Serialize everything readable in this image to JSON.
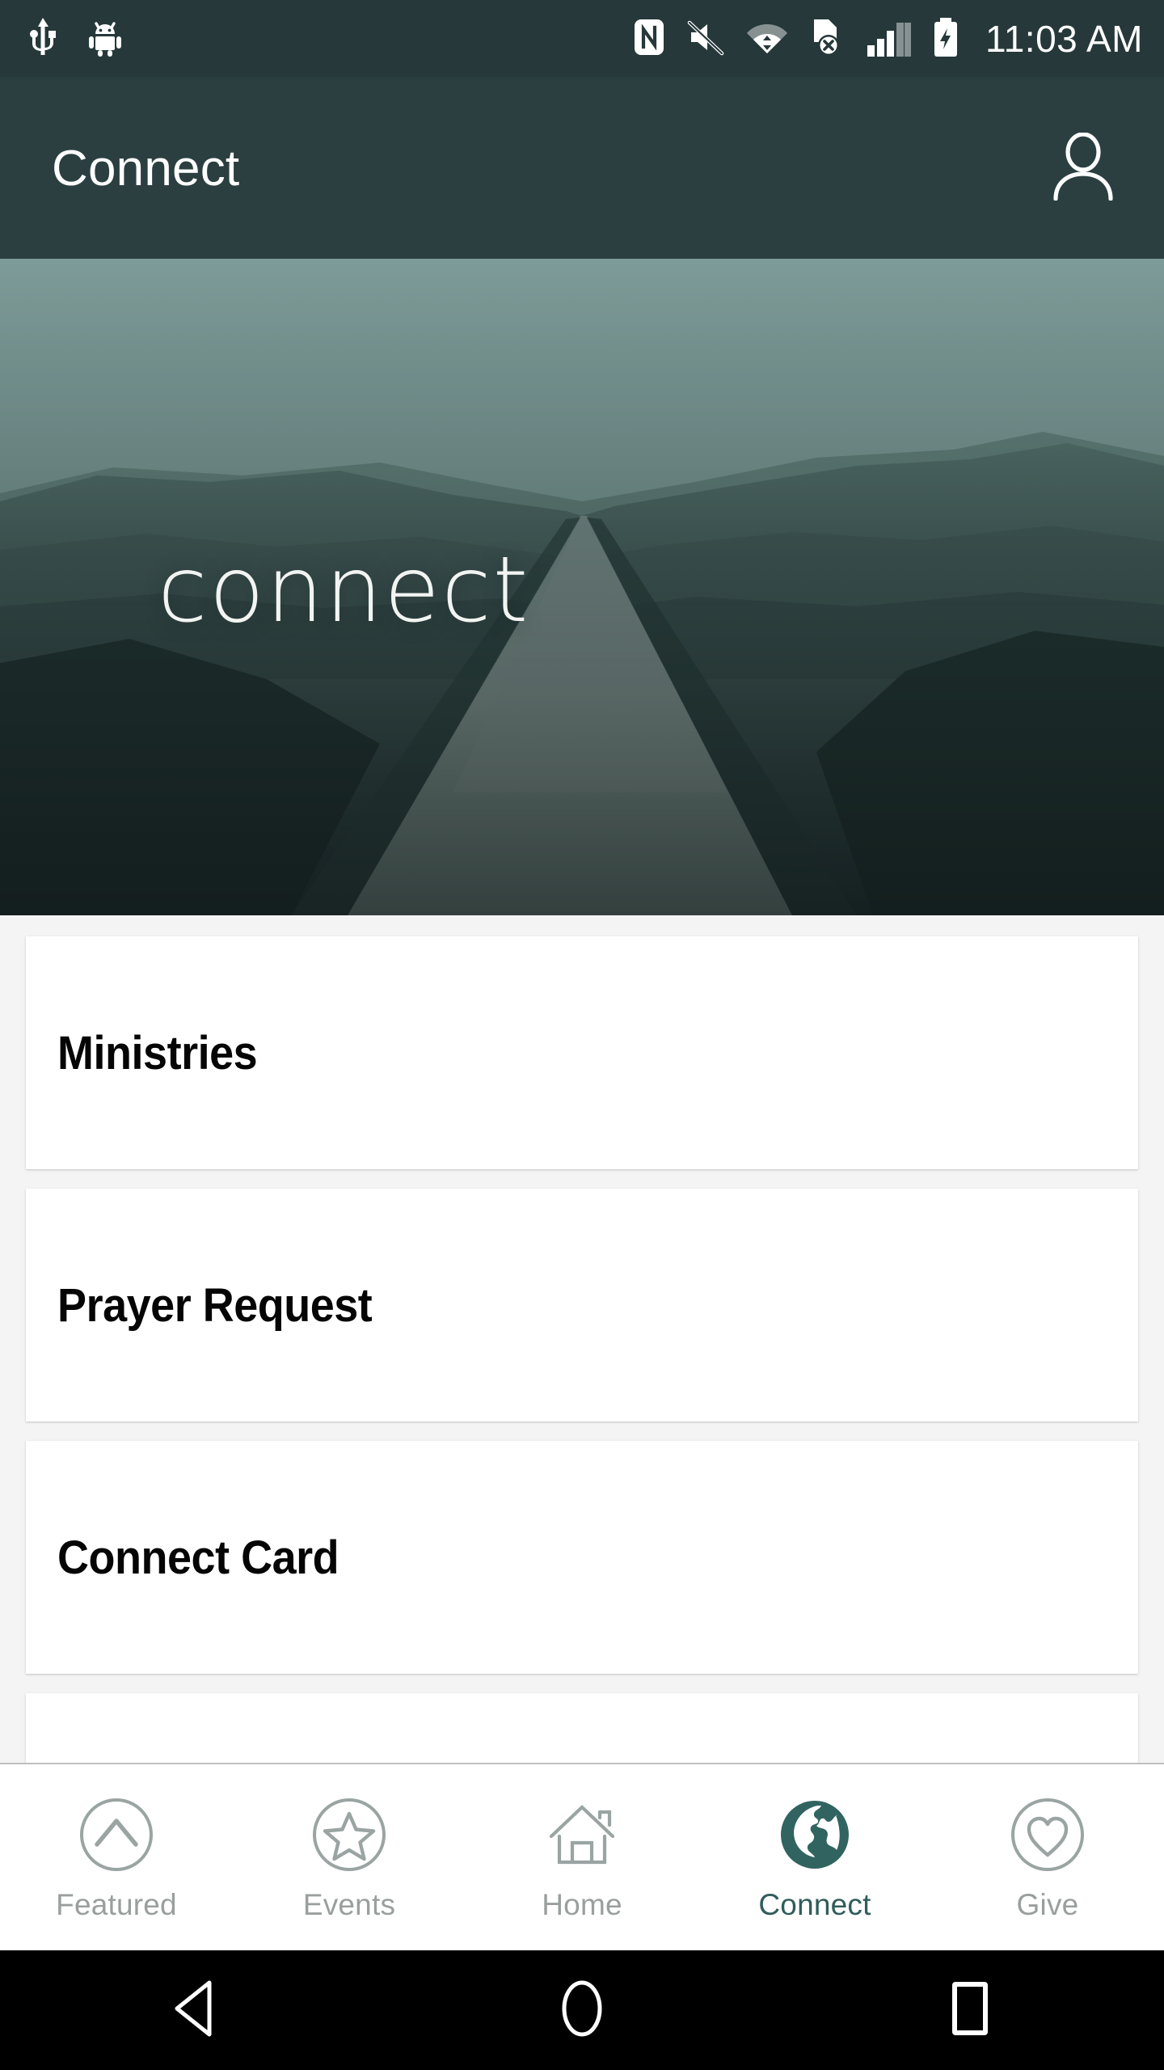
{
  "status_bar": {
    "time": "11:03 AM",
    "left_icons": [
      "usb-icon",
      "android-debug-icon"
    ],
    "right_icons": [
      "nfc-icon",
      "volume-muted-icon",
      "wifi-icon",
      "sim-card-error-icon",
      "signal-bars-icon",
      "battery-charging-icon"
    ],
    "background_color": "#26383a",
    "icon_color": "#ffffff"
  },
  "app_bar": {
    "title": "Connect",
    "profile_icon": "person-icon",
    "background_color": "#2b3f41",
    "text_color": "#ffffff"
  },
  "hero": {
    "wordmark": "connect",
    "image_description": "desert road receding between hills",
    "sky_color": "#6e8f8d",
    "land_color": "#3d5553",
    "road_color": "#7d9290",
    "wordmark_color": "#f2f4f2"
  },
  "list": {
    "items": [
      {
        "label": "Ministries"
      },
      {
        "label": "Prayer Request"
      },
      {
        "label": "Connect Card"
      },
      {
        "label": ""
      }
    ],
    "card_background": "#ffffff",
    "page_background": "#f4f4f4",
    "title_color": "#050505"
  },
  "tab_bar": {
    "active_color": "#2f5d5a",
    "inactive_color": "#9a9f9e",
    "tabs": [
      {
        "label": "Featured",
        "icon": "chevron-up-circle-icon",
        "active": false
      },
      {
        "label": "Events",
        "icon": "star-circle-icon",
        "active": false
      },
      {
        "label": "Home",
        "icon": "house-icon",
        "active": false
      },
      {
        "label": "Connect",
        "icon": "globe-icon",
        "active": true
      },
      {
        "label": "Give",
        "icon": "heart-circle-icon",
        "active": false
      }
    ]
  },
  "system_nav": {
    "background_color": "#000000",
    "buttons": [
      {
        "name": "back-button",
        "icon": "triangle-left-icon"
      },
      {
        "name": "home-button",
        "icon": "circle-icon"
      },
      {
        "name": "recents-button",
        "icon": "square-icon"
      }
    ]
  }
}
